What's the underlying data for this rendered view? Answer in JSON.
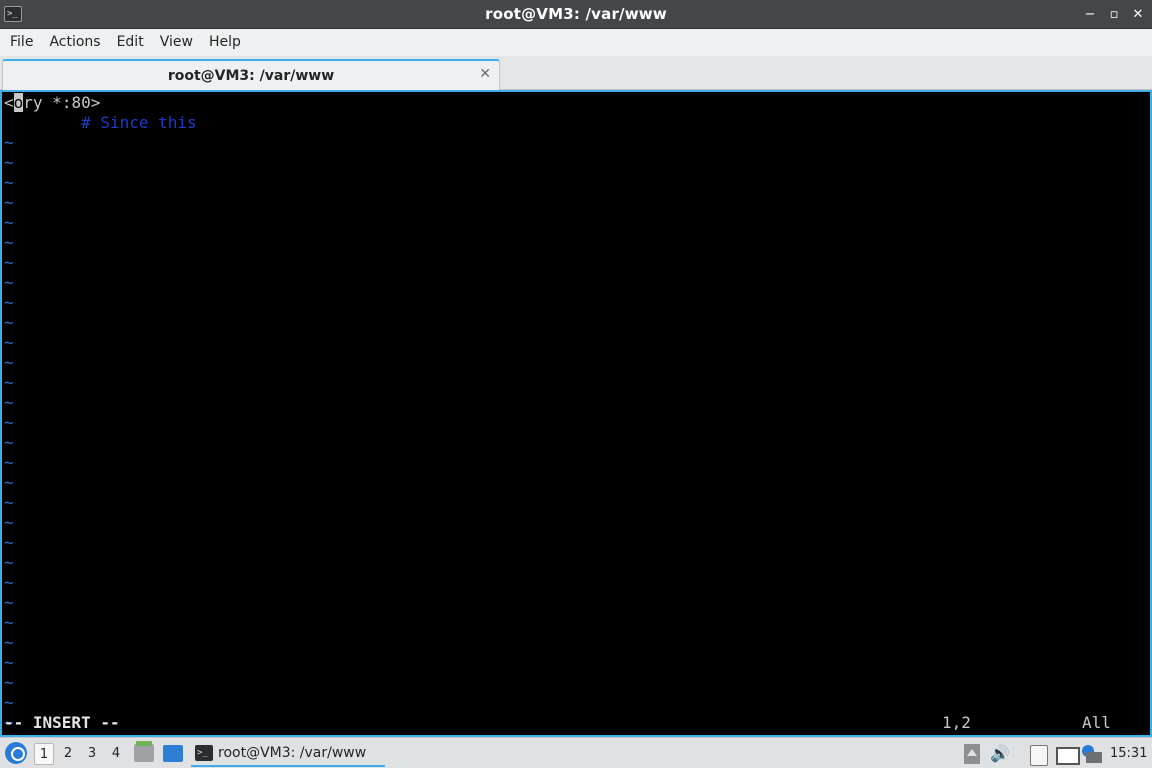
{
  "window": {
    "title": "root@VM3: /var/www",
    "app_icon": ">_",
    "controls": [
      "−",
      "▫",
      "✕"
    ]
  },
  "menu": {
    "items": [
      "File",
      "Actions",
      "Edit",
      "View",
      "Help"
    ]
  },
  "tab": {
    "label": "root@VM3: /var/www",
    "close": "✕"
  },
  "terminal": {
    "line1_first": "<",
    "line1_cursor": "o",
    "line1_rest": "ry *:80>",
    "line2": "        # Since this",
    "tilde": "~",
    "tilde_count": 30,
    "mode": "-- INSERT --",
    "position": "1,2",
    "scroll": "All"
  },
  "taskbar": {
    "workspaces": [
      "1",
      "2",
      "3",
      "4"
    ],
    "active_workspace": "1",
    "window_label": "root@VM3: /var/www",
    "window_icon": ">_",
    "sound_icon": "🔊",
    "clock": "15:31"
  },
  "colors": {
    "accent": "#3daee9",
    "titlebar": "#44474a",
    "tilde": "#1d6fd1",
    "comment": "#1e3cc8"
  }
}
